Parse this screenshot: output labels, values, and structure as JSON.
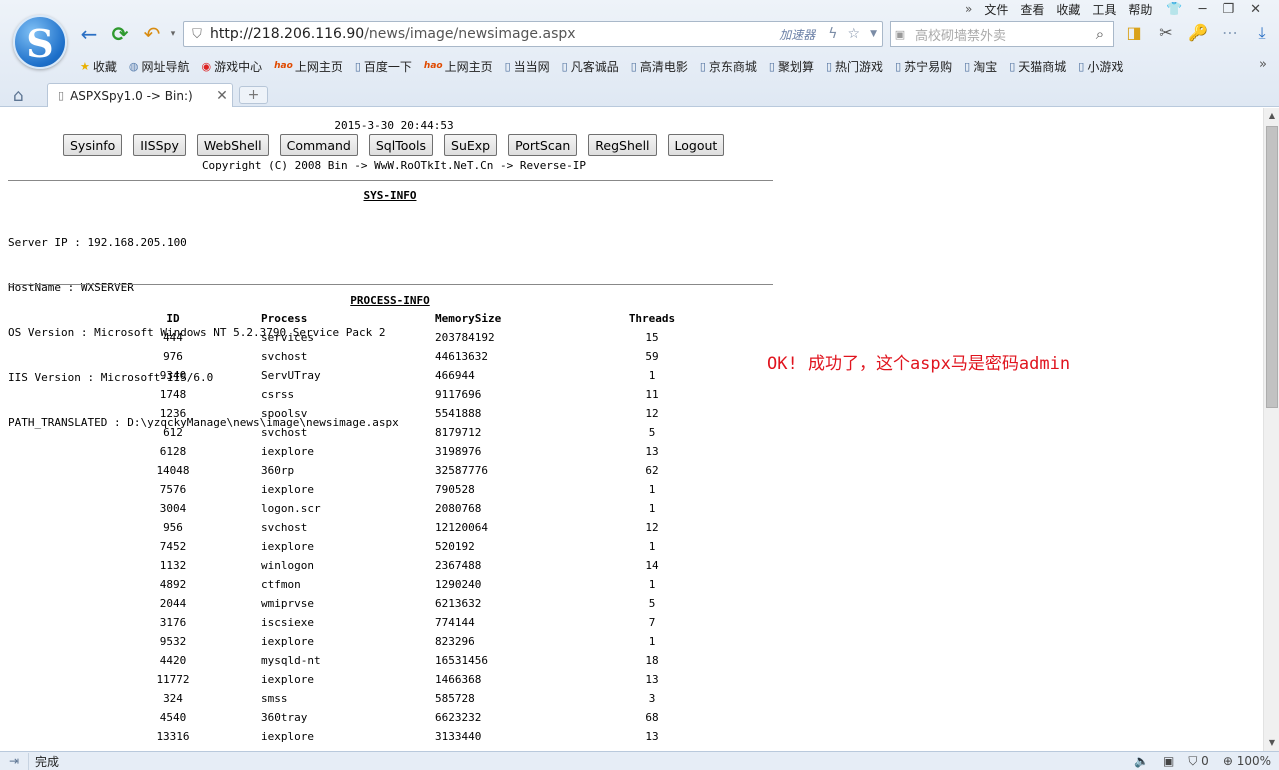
{
  "browser": {
    "menu": [
      "文件",
      "查看",
      "收藏",
      "工具",
      "帮助"
    ],
    "url_host": "http://218.206.116.90",
    "url_path": "/news/image/newsimage.aspx",
    "accelerator_label": "加速器",
    "search_placeholder": "高校砌墙禁外卖",
    "bookmarks": [
      {
        "label": "收藏",
        "icon": "star-icon"
      },
      {
        "label": "网址导航",
        "icon": "globe-icon"
      },
      {
        "label": "游戏中心",
        "icon": "game-icon"
      },
      {
        "label": "上网主页",
        "icon": "hao-icon"
      },
      {
        "label": "百度一下",
        "icon": "page-icon"
      },
      {
        "label": "上网主页",
        "icon": "hao-icon"
      },
      {
        "label": "当当网",
        "icon": "page-icon"
      },
      {
        "label": "凡客诚品",
        "icon": "page-icon"
      },
      {
        "label": "高清电影",
        "icon": "page-icon"
      },
      {
        "label": "京东商城",
        "icon": "page-icon"
      },
      {
        "label": "聚划算",
        "icon": "page-icon"
      },
      {
        "label": "热门游戏",
        "icon": "page-icon"
      },
      {
        "label": "苏宁易购",
        "icon": "page-icon"
      },
      {
        "label": "淘宝",
        "icon": "page-icon"
      },
      {
        "label": "天猫商城",
        "icon": "page-icon"
      },
      {
        "label": "小游戏",
        "icon": "page-icon"
      }
    ],
    "hao_mark": "hao",
    "tab_title": "ASPXSpy1.0 -> Bin:)",
    "status_text": "完成",
    "status_count": "0",
    "zoom": "100%"
  },
  "page": {
    "datetime": "2015-3-30 20:44:53",
    "buttons": [
      "Sysinfo",
      "IISSpy",
      "WebShell",
      "Command",
      "SqlTools",
      "SuExp",
      "PortScan",
      "RegShell",
      "Logout"
    ],
    "copyright": "Copyright (C) 2008 Bin -> WwW.RoOTkIt.NeT.Cn -> Reverse-IP",
    "sysinfo_title": "SYS-INFO",
    "sysinfo_lines": [
      "Server IP : 192.168.205.100",
      "HostName : WXSERVER",
      "OS Version : Microsoft Windows NT 5.2.3790 Service Pack 2",
      "IIS Version : Microsoft-IIS/6.0",
      "PATH_TRANSLATED : D:\\yzqckyManage\\news\\image\\newsimage.aspx"
    ],
    "process_title": "PROCESS-INFO",
    "process_headers": [
      "ID",
      "Process",
      "MemorySize",
      "Threads"
    ],
    "processes": [
      [
        "444",
        "services",
        "203784192",
        "15"
      ],
      [
        "976",
        "svchost",
        "44613632",
        "59"
      ],
      [
        "9340",
        "ServUTray",
        "466944",
        "1"
      ],
      [
        "1748",
        "csrss",
        "9117696",
        "11"
      ],
      [
        "1236",
        "spoolsv",
        "5541888",
        "12"
      ],
      [
        "612",
        "svchost",
        "8179712",
        "5"
      ],
      [
        "6128",
        "iexplore",
        "3198976",
        "13"
      ],
      [
        "14048",
        "360rp",
        "32587776",
        "62"
      ],
      [
        "7576",
        "iexplore",
        "790528",
        "1"
      ],
      [
        "3004",
        "logon.scr",
        "2080768",
        "1"
      ],
      [
        "956",
        "svchost",
        "12120064",
        "12"
      ],
      [
        "7452",
        "iexplore",
        "520192",
        "1"
      ],
      [
        "1132",
        "winlogon",
        "2367488",
        "14"
      ],
      [
        "4892",
        "ctfmon",
        "1290240",
        "1"
      ],
      [
        "2044",
        "wmiprvse",
        "6213632",
        "5"
      ],
      [
        "3176",
        "iscsiexe",
        "774144",
        "7"
      ],
      [
        "9532",
        "iexplore",
        "823296",
        "1"
      ],
      [
        "4420",
        "mysqld-nt",
        "16531456",
        "18"
      ],
      [
        "11772",
        "iexplore",
        "1466368",
        "13"
      ],
      [
        "324",
        "smss",
        "585728",
        "3"
      ],
      [
        "4540",
        "360tray",
        "6623232",
        "68"
      ],
      [
        "13316",
        "iexplore",
        "3133440",
        "13"
      ]
    ],
    "note": "OK! 成功了，这个aspx马是密码admin",
    "note_color": "#e0141e"
  }
}
